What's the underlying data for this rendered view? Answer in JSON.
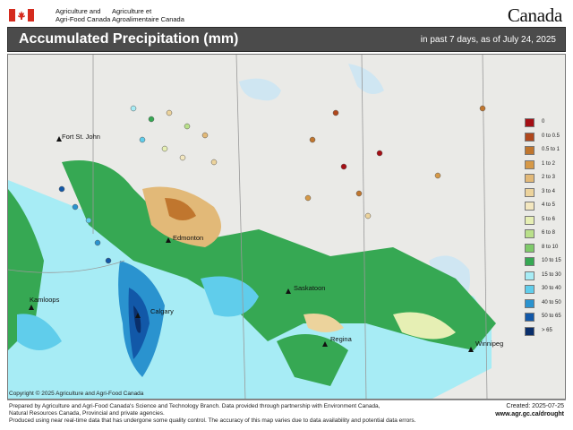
{
  "header": {
    "agency_en_line1": "Agriculture and",
    "agency_en_line2": "Agri-Food Canada",
    "agency_fr_line1": "Agriculture et",
    "agency_fr_line2": "Agroalimentaire Canada",
    "wordmark": "Canada",
    "title": "Accumulated Precipitation (mm)",
    "subtitle": "in past 7 days, as of July 24, 2025"
  },
  "legend": [
    {
      "label": "0",
      "color": "#a50f15"
    },
    {
      "label": "0 to 0.5",
      "color": "#b0471c"
    },
    {
      "label": "0.5 to 1",
      "color": "#c0762e"
    },
    {
      "label": "1 to 2",
      "color": "#d69947"
    },
    {
      "label": "2 to 3",
      "color": "#e2b978"
    },
    {
      "label": "3 to 4",
      "color": "#ecd39c"
    },
    {
      "label": "4 to 5",
      "color": "#f3e7bf"
    },
    {
      "label": "5 to 6",
      "color": "#e6efb4"
    },
    {
      "label": "6 to 8",
      "color": "#b9e08a"
    },
    {
      "label": "8 to 10",
      "color": "#7fca6a"
    },
    {
      "label": "10 to 15",
      "color": "#36a853"
    },
    {
      "label": "15 to 30",
      "color": "#a7ecf5"
    },
    {
      "label": "30 to 40",
      "color": "#60cdeb"
    },
    {
      "label": "40 to 50",
      "color": "#2a93cf"
    },
    {
      "label": "50 to 65",
      "color": "#1258a8"
    },
    {
      "label": "> 65",
      "color": "#0a2f6b"
    }
  ],
  "cities": [
    {
      "name": "Fort St. John"
    },
    {
      "name": "Edmonton"
    },
    {
      "name": "Kamloops"
    },
    {
      "name": "Calgary"
    },
    {
      "name": "Saskatoon"
    },
    {
      "name": "Regina"
    },
    {
      "name": "Winnipeg"
    }
  ],
  "copyright": "Copyright © 2025 Agriculture and Agri-Food Canada",
  "footer": {
    "line1": "Prepared by Agriculture and Agri-Food Canada's Science and Technology Branch. Data provided through partnership with Environment Canada,",
    "line2": "Natural Resources Canada, Provincial and private agencies.",
    "line3": "Produced using near real-time data that has undergone some quality control. The accuracy of this map varies due to data availability and potential data errors.",
    "created": "Created: 2025-07-25",
    "site": "www.agr.gc.ca/drought"
  }
}
